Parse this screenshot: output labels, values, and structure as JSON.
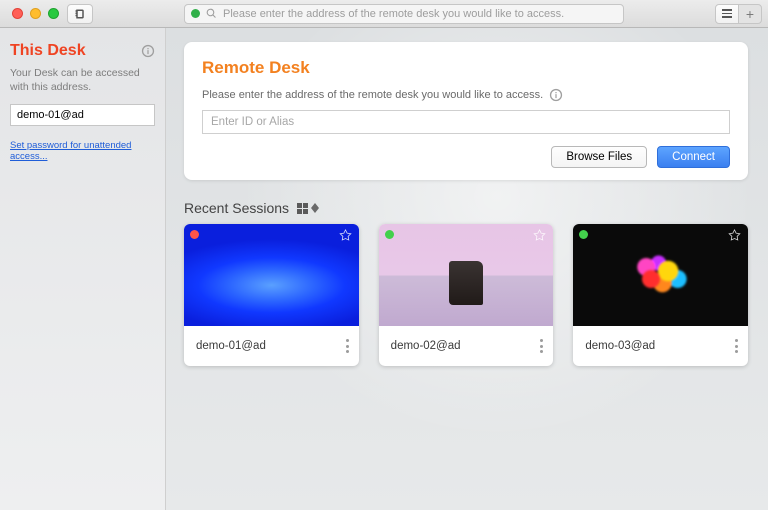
{
  "toolbar": {
    "search_placeholder": "Please enter the address of the remote desk you would like to access."
  },
  "sidebar": {
    "title": "This Desk",
    "subtitle": "Your Desk can be accessed with this address.",
    "address_value": "demo-01@ad",
    "password_link": "Set password for unattended access..."
  },
  "remote": {
    "title": "Remote Desk",
    "subtitle": "Please enter the address of the remote desk you would like to access.",
    "input_placeholder": "Enter ID or Alias",
    "browse_label": "Browse Files",
    "connect_label": "Connect"
  },
  "sessions": {
    "title": "Recent Sessions",
    "items": [
      {
        "name": "demo-01@ad",
        "status": "red"
      },
      {
        "name": "demo-02@ad",
        "status": "green"
      },
      {
        "name": "demo-03@ad",
        "status": "green"
      }
    ]
  }
}
